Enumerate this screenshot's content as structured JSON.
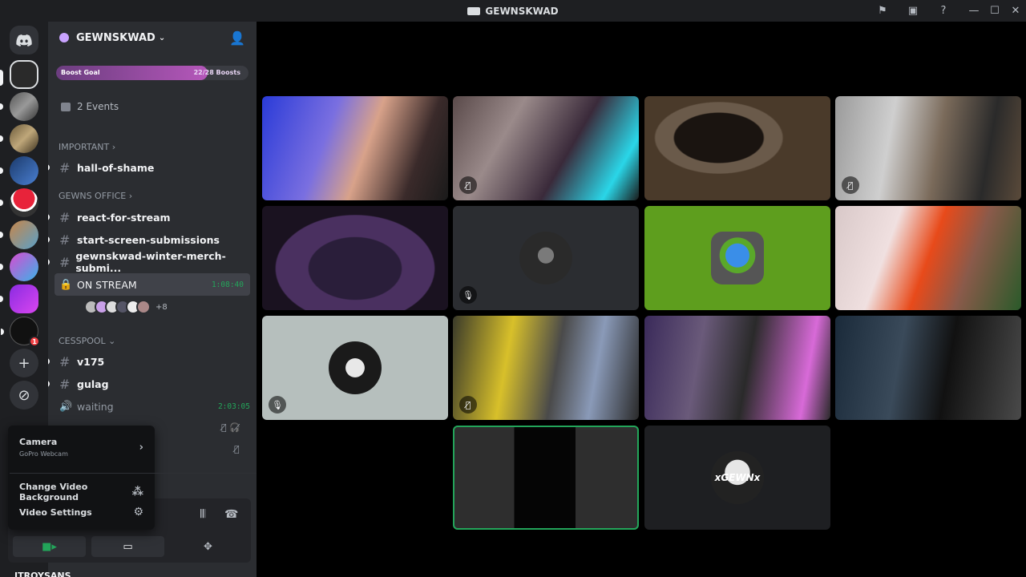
{
  "window": {
    "title": "GEWNSKWAD",
    "icons": [
      "flag-icon",
      "stream-icon",
      "help-icon",
      "minimize-icon",
      "maximize-icon",
      "close-icon"
    ]
  },
  "rail": {
    "mention_badge": "1"
  },
  "server": {
    "name": "GEWNSKWAD",
    "boost_label": "Boost Goal",
    "boost_count": "22/28 Boosts",
    "boost_progress": 0.786,
    "events": "2 Events"
  },
  "categories": {
    "important": "IMPORTANT",
    "office": "GEWNS OFFICE",
    "cesspool": "CESSPOOL"
  },
  "channels": {
    "hall": "hall-of-shame",
    "react": "react-for-stream",
    "start": "start-screen-submissions",
    "merch": "gewnskwad-winter-merch-submi...",
    "on_stream": "ON STREAM",
    "on_stream_timer": "1:08:40",
    "on_stream_more": "+8",
    "v175": "v175",
    "gulag": "gulag",
    "waiting": "waiting",
    "waiting_timer": "2:03:05"
  },
  "popup": {
    "camera_label": "Camera",
    "camera_device": "GoPro Webcam",
    "bg_label": "Change Video Background",
    "settings_label": "Video Settings"
  },
  "user": {
    "name": "JTROYSANS"
  },
  "tile_labels": {
    "xgewnx": "xGEWNx"
  },
  "colors": {
    "accent_green": "#23a55a",
    "boost_purple": "#b557ba",
    "green_screen": "#5e9e1e"
  }
}
